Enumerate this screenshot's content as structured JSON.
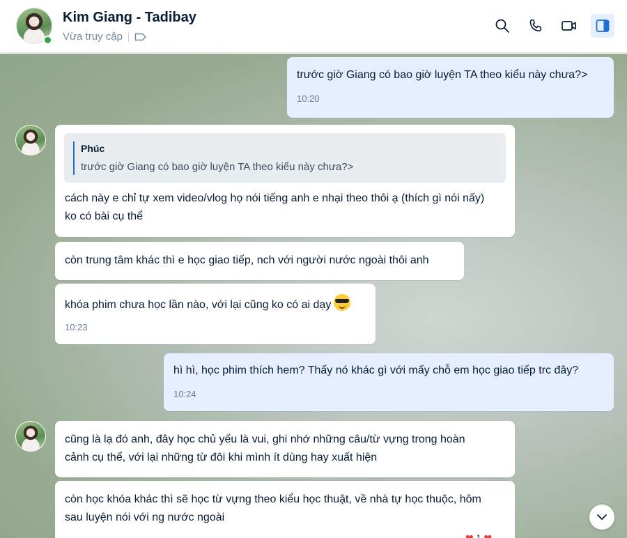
{
  "header": {
    "contact_name": "Kim Giang - Tadibay",
    "status": "Vừa truy cập",
    "icons": [
      "search-icon",
      "phone-icon",
      "video-call-icon",
      "sidebar-toggle-icon"
    ]
  },
  "messages": [
    {
      "sender": "me",
      "text": "trước giờ Giang có bao giờ luyện TA theo kiểu này chưa?>",
      "time": "10:20"
    },
    {
      "sender": "them",
      "quote_author": "Phúc",
      "quote_text": "trước giờ Giang có bao giờ luyện TA theo kiểu này chưa?>",
      "text": "cách này e chỉ tự xem video/vlog họ nói tiếng anh e nhại theo thôi ạ (thích gì nói nấy) ko có bài cụ thể"
    },
    {
      "sender": "them",
      "text": "còn trung tâm khác thì e học giao tiếp, nch với người nước ngoài thôi anh"
    },
    {
      "sender": "them",
      "text": "khóa phim chưa học lần nào, với lại cũng ko có ai dạy",
      "emoji": "sunglasses-emoji",
      "time": "10:23"
    },
    {
      "sender": "me",
      "text": "hì hì, học phim thích hem? Thấy nó khác gì với mấy chỗ em học giao tiếp trc đây?",
      "time": "10:24"
    },
    {
      "sender": "them",
      "text": "cũng là lạ đó anh, đây học chủ yếu là vui, ghi nhớ những câu/từ vựng trong hoàn cảnh cụ thể, với lại những từ đôi khi mình ít dùng hay xuất hiện"
    },
    {
      "sender": "them",
      "text": "còn học khóa khác thì sẽ học từ vựng theo kiểu học thuật, về nhà tự học thuộc, hôm sau luyện nói với ng nước ngoài"
    }
  ],
  "reaction": {
    "icon": "heart-icon",
    "count": "1"
  },
  "colors": {
    "my_bubble": "#e5efff",
    "their_bubble": "#ffffff",
    "online": "#30a14e",
    "accent": "#1e6fd9"
  }
}
